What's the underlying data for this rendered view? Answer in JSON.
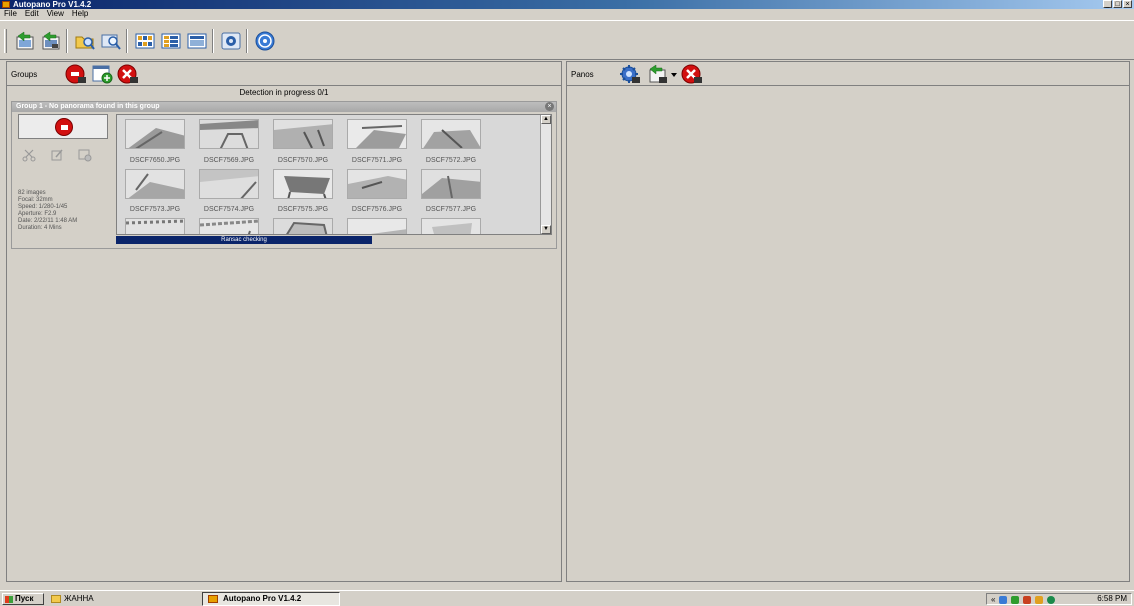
{
  "window": {
    "title": "Autopano Pro V1.4.2",
    "controls": [
      "_",
      "□",
      "×"
    ]
  },
  "menu": {
    "items": [
      "File",
      "Edit",
      "View",
      "Help"
    ]
  },
  "groups_panel": {
    "title": "Groups",
    "detection_status": "Detection in progress 0/1",
    "group": {
      "header": "Group 1 - No panorama found in this group",
      "info": {
        "images": "82 images",
        "focal": "Focal: 32mm",
        "speed": "Speed: 1/280-1/45",
        "aperture": "Aperture: F2.9",
        "date": "Date: 2/22/11 1:48 AM",
        "duration": "Duration: 4 Mins"
      },
      "files": [
        "DSCF7650.JPG",
        "DSCF7569.JPG",
        "DSCF7570.JPG",
        "DSCF7571.JPG",
        "DSCF7572.JPG",
        "DSCF7573.JPG",
        "DSCF7574.JPG",
        "DSCF7575.JPG",
        "DSCF7576.JPG",
        "DSCF7577.JPG"
      ],
      "progress_label": "Ransac checking"
    }
  },
  "panos_panel": {
    "title": "Panos"
  },
  "taskbar": {
    "start": "Пуск",
    "quick_launch": "ЖАННА",
    "task": "Autopano Pro V1.4.2",
    "tray_arrows": "«",
    "clock": "6:58 PM"
  },
  "colors": {
    "title_bar": "#0a246a",
    "progress": "#0a246a",
    "stop_red": "#d21010",
    "face": "#d4d0c8"
  }
}
